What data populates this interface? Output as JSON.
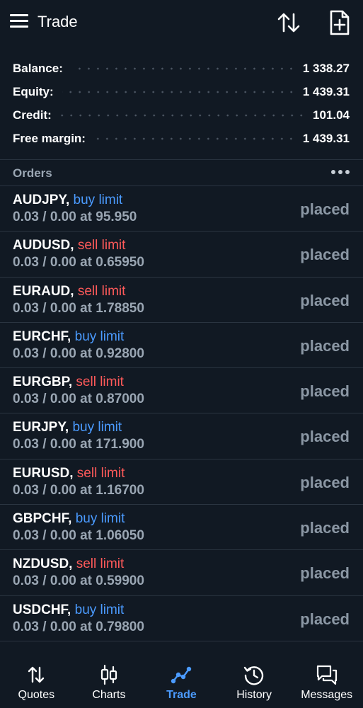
{
  "header": {
    "title": "Trade",
    "icons": [
      "menu-icon",
      "sort-icon",
      "new-order-icon"
    ]
  },
  "summary": [
    {
      "label": "Balance:",
      "value": "1 338.27"
    },
    {
      "label": "Equity:",
      "value": "1 439.31"
    },
    {
      "label": "Credit:",
      "value": "101.04"
    },
    {
      "label": "Free margin:",
      "value": "1 439.31"
    }
  ],
  "orders_section": {
    "title": "Orders",
    "more_icon": "more-horizontal-icon"
  },
  "orders": [
    {
      "symbol": "AUDJPY,",
      "type": "buy limit",
      "side": "buy",
      "details": "0.03 / 0.00 at 95.950",
      "status": "placed"
    },
    {
      "symbol": "AUDUSD,",
      "type": "sell limit",
      "side": "sell",
      "details": "0.03 / 0.00 at 0.65950",
      "status": "placed"
    },
    {
      "symbol": "EURAUD,",
      "type": "sell limit",
      "side": "sell",
      "details": "0.03 / 0.00 at 1.78850",
      "status": "placed"
    },
    {
      "symbol": "EURCHF,",
      "type": "buy limit",
      "side": "buy",
      "details": "0.03 / 0.00 at 0.92800",
      "status": "placed"
    },
    {
      "symbol": "EURGBP,",
      "type": "sell limit",
      "side": "sell",
      "details": "0.03 / 0.00 at 0.87000",
      "status": "placed"
    },
    {
      "symbol": "EURJPY,",
      "type": "buy limit",
      "side": "buy",
      "details": "0.03 / 0.00 at 171.900",
      "status": "placed"
    },
    {
      "symbol": "EURUSD,",
      "type": "sell limit",
      "side": "sell",
      "details": "0.03 / 0.00 at 1.16700",
      "status": "placed"
    },
    {
      "symbol": "GBPCHF,",
      "type": "buy limit",
      "side": "buy",
      "details": "0.03 / 0.00 at 1.06050",
      "status": "placed"
    },
    {
      "symbol": "NZDUSD,",
      "type": "sell limit",
      "side": "sell",
      "details": "0.03 / 0.00 at 0.59900",
      "status": "placed"
    },
    {
      "symbol": "USDCHF,",
      "type": "buy limit",
      "side": "buy",
      "details": "0.03 / 0.00 at 0.79800",
      "status": "placed"
    }
  ],
  "bottom_nav": [
    {
      "label": "Quotes",
      "icon": "quotes-icon",
      "active": false
    },
    {
      "label": "Charts",
      "icon": "charts-icon",
      "active": false
    },
    {
      "label": "Trade",
      "icon": "trade-icon",
      "active": true
    },
    {
      "label": "History",
      "icon": "history-icon",
      "active": false
    },
    {
      "label": "Messages",
      "icon": "messages-icon",
      "active": false
    }
  ],
  "colors": {
    "background": "#111923",
    "buy": "#4b9bff",
    "sell": "#ff5a5a",
    "muted": "#9aa6b3",
    "active_tab": "#4b9bff"
  }
}
